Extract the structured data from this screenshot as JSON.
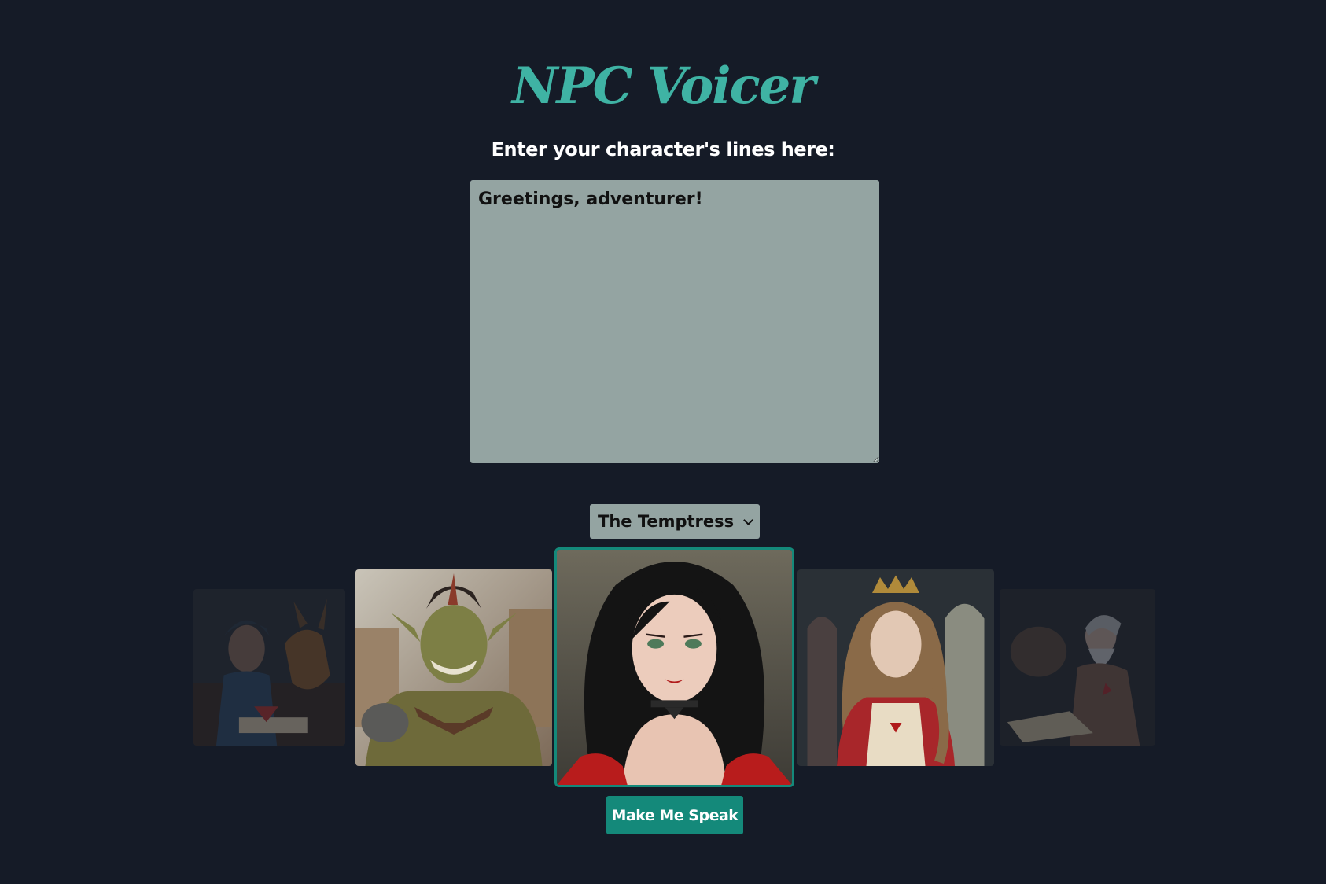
{
  "header": {
    "title": "NPC Voicer",
    "prompt_label": "Enter your character's lines here:"
  },
  "lines_input": {
    "value": "Greetings, adventurer!"
  },
  "voice_select": {
    "selected": "The Temptress"
  },
  "carousel": {
    "selected_index": 2,
    "portraits": [
      {
        "name": "portrait-scholar-with-dragon"
      },
      {
        "name": "portrait-orc-warrior"
      },
      {
        "name": "portrait-temptress"
      },
      {
        "name": "portrait-princess"
      },
      {
        "name": "portrait-old-wizard"
      }
    ]
  },
  "actions": {
    "speak_label": "Make Me Speak"
  },
  "colors": {
    "background": "#151b27",
    "accent": "#14897a",
    "title": "#3fb3a4",
    "input_bg": "#94a4a2"
  }
}
